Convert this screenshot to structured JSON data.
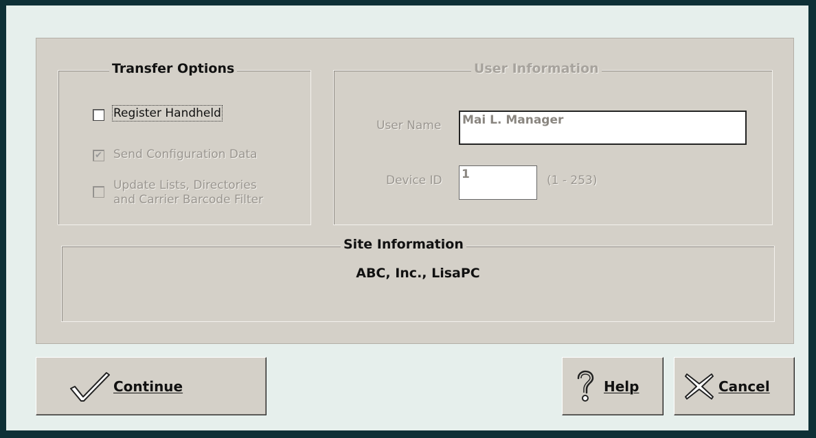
{
  "transfer_options": {
    "title": "Transfer Options",
    "register_handheld": {
      "label": "Register Handheld",
      "checked": false,
      "enabled": true
    },
    "send_configuration": {
      "label": "Send Configuration Data",
      "checked": true,
      "enabled": false
    },
    "update_lists": {
      "label_line1": "Update Lists, Directories",
      "label_line2": "and Carrier Barcode Filter",
      "checked": false,
      "enabled": false
    }
  },
  "user_information": {
    "title": "User Information",
    "user_name_label": "User Name",
    "user_name_value": "Mai L. Manager",
    "device_id_label": "Device ID",
    "device_id_value": "1",
    "device_id_range": "(1 - 253)"
  },
  "site_information": {
    "title": "Site Information",
    "value": "ABC, Inc., LisaPC"
  },
  "buttons": {
    "continue_label": "Continue",
    "help_label": "Help",
    "cancel_label": "Cancel"
  },
  "icons": {
    "continue": "checkmark-icon",
    "help": "question-mark-icon",
    "cancel": "x-icon"
  }
}
